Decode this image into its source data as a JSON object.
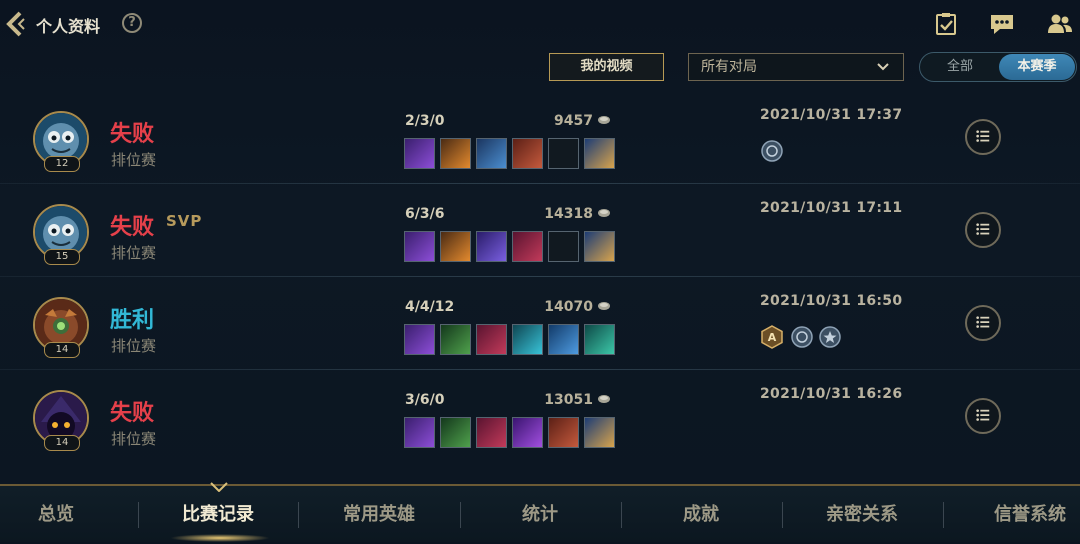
{
  "header": {
    "title": "个人资料",
    "help_icon": "?",
    "icons": [
      "checklist-icon",
      "chat-icon",
      "friends-icon"
    ]
  },
  "toolbar": {
    "my_video_label": "我的视频",
    "filter_value": "所有对局",
    "segment": {
      "all_label": "全部",
      "season_label": "本赛季",
      "selected": "本赛季"
    }
  },
  "matches": [
    {
      "result": "失败",
      "svp": "",
      "mode": "排位赛",
      "level": "12",
      "kda": "2/3/0",
      "gold": "9457",
      "time": "2021/10/31 17:37",
      "badges": [
        "rank-badge-icon"
      ]
    },
    {
      "result": "失败",
      "svp": "SVP",
      "mode": "排位赛",
      "level": "15",
      "kda": "6/3/6",
      "gold": "14318",
      "time": "2021/10/31 17:11",
      "badges": []
    },
    {
      "result": "胜利",
      "svp": "",
      "mode": "排位赛",
      "level": "14",
      "kda": "4/4/12",
      "gold": "14070",
      "time": "2021/10/31 16:50",
      "badges": [
        "a-grade-badge-icon",
        "rank-badge-icon",
        "star-badge-icon"
      ]
    },
    {
      "result": "失败",
      "svp": "",
      "mode": "排位赛",
      "level": "14",
      "kda": "3/6/0",
      "gold": "13051",
      "time": "2021/10/31 16:26",
      "badges": []
    }
  ],
  "tabs": [
    {
      "label": "总览",
      "active": false
    },
    {
      "label": "比赛记录",
      "active": true
    },
    {
      "label": "常用英雄",
      "active": false
    },
    {
      "label": "统计",
      "active": false
    },
    {
      "label": "成就",
      "active": false
    },
    {
      "label": "亲密关系",
      "active": false
    },
    {
      "label": "信誉系统",
      "active": false
    }
  ],
  "colors": {
    "lose": "#e5404a",
    "win": "#32b8d6",
    "gold_border": "#a88a4c",
    "active_tab": "#f1ead2"
  }
}
